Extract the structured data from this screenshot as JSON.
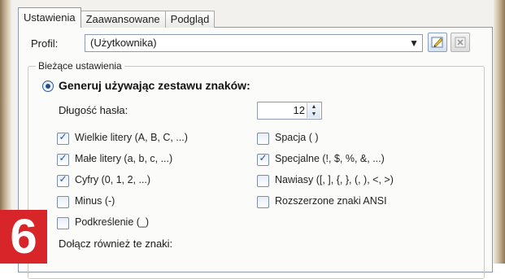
{
  "tabs": [
    {
      "label": "Ustawienia",
      "active": true
    },
    {
      "label": "Zaawansowane",
      "active": false
    },
    {
      "label": "Podgląd",
      "active": false
    }
  ],
  "profile": {
    "label": "Profil:",
    "value": "(Użytkownika)",
    "edit_icon": "edit-profile-icon",
    "delete_icon": "delete-profile-icon"
  },
  "group": {
    "title": "Bieżące ustawienia",
    "mode_label": "Generuj używając zestawu znaków:",
    "mode_selected": true,
    "length_label": "Długość hasła:",
    "length_value": "12",
    "also_label": "Dołącz również te znaki:"
  },
  "options_left": [
    {
      "label": "Wielkie litery (A, B, C, ...)",
      "checked": true
    },
    {
      "label": "Małe litery (a, b, c, ...)",
      "checked": true
    },
    {
      "label": "Cyfry (0, 1, 2, ...)",
      "checked": true
    },
    {
      "label": "Minus (-)",
      "checked": false
    },
    {
      "label": "Podkreślenie (_)",
      "checked": false
    }
  ],
  "options_right": [
    {
      "label": "Spacja ( )",
      "checked": false
    },
    {
      "label": "Specjalne (!, $, %, &, ...)",
      "checked": true
    },
    {
      "label": "Nawiasy ([, ], {, }, (, ), <, >)",
      "checked": false
    },
    {
      "label": "Rozszerzone znaki ANSI",
      "checked": false
    }
  ],
  "badge": {
    "number": "6",
    "color": "#d8252a"
  },
  "colors": {
    "accent": "#2a4f9a",
    "panel": "#fbfbf9",
    "window": "#f2f1ed"
  }
}
